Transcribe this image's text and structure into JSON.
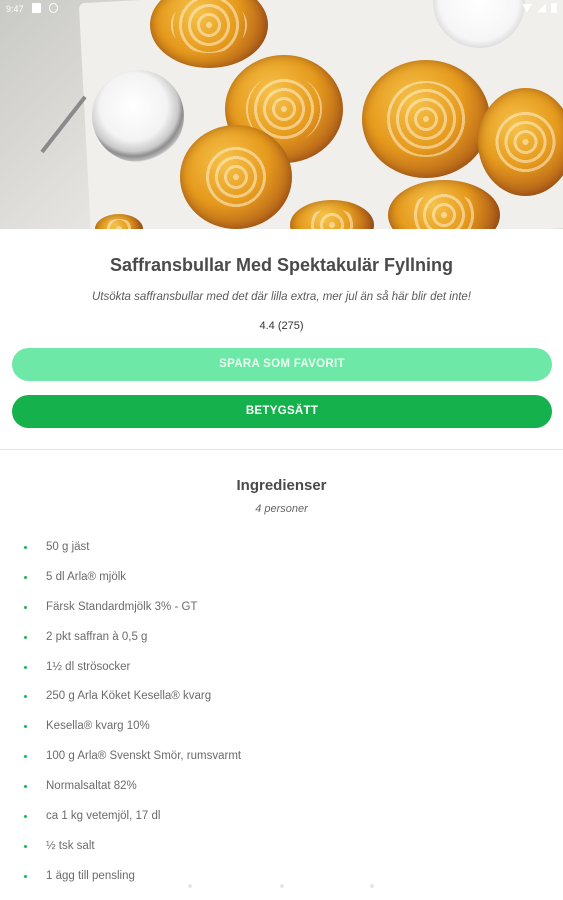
{
  "status_bar": {
    "time": "9:47",
    "icons": [
      "sd-card-icon",
      "circle-icon",
      "wifi-icon",
      "signal-icon",
      "battery-icon"
    ]
  },
  "hero": {
    "image": "saffron-buns-photo"
  },
  "recipe": {
    "title": "Saffransbullar Med Spektakulär Fyllning",
    "subtitle": "Utsökta saffransbullar med det där lilla extra, mer jul än så här blir det inte!",
    "rating": "4.4 (275)"
  },
  "actions": {
    "favorite_label": "SPARA SOM FAVORIT",
    "rate_label": "BETYGSÄTT",
    "favorite_color": "#6de8a6",
    "rate_color": "#14b14c"
  },
  "ingredients": {
    "title": "Ingredienser",
    "servings": "4 personer",
    "items": [
      "50 g jäst",
      "5 dl Arla® mjölk",
      "Färsk Standardmjölk 3% - GT",
      "2 pkt saffran à 0,5 g",
      "1½ dl strösocker",
      "250 g Arla Köket Kesella® kvarg",
      "Kesella® kvarg 10%",
      "100 g Arla® Svenskt Smör, rumsvarmt",
      "Normalsaltat 82%",
      "ca 1 kg vetemjöl, 17 dl",
      "½ tsk salt",
      "1 ägg till pensling"
    ]
  }
}
